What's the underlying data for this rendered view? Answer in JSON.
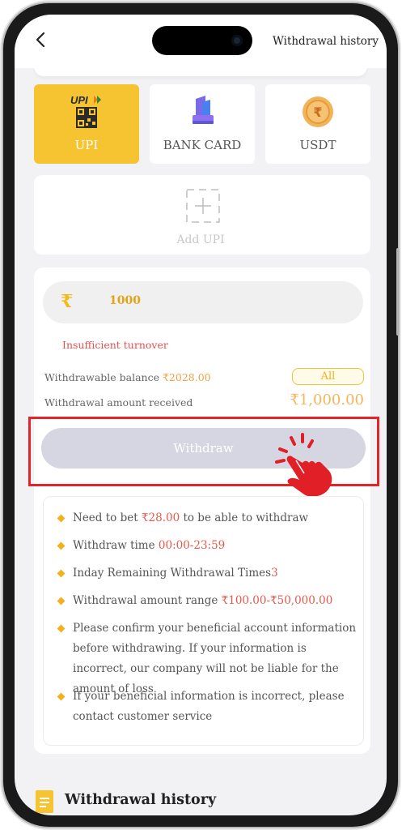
{
  "header": {
    "history_link": "Withdrawal history"
  },
  "methods": [
    {
      "label": "UPI",
      "active": true
    },
    {
      "label": "BANK CARD",
      "active": false
    },
    {
      "label": "USDT",
      "active": false
    }
  ],
  "upi_logo_text": "UPI",
  "add_upi": {
    "label": "Add UPI"
  },
  "amount": {
    "currency_symbol": "₹",
    "value": "1000",
    "warning": "Insufficient turnover"
  },
  "balance": {
    "label": "Withdrawable balance ",
    "value": "₹2028.00",
    "all_button": "All"
  },
  "received": {
    "label": "Withdrawal amount received",
    "value": "₹1,000.00"
  },
  "withdraw_button": "Withdraw",
  "rules": {
    "r1_pre": "Need to bet ",
    "r1_val": "₹28.00",
    "r1_post": " to be able to withdraw",
    "r2_pre": "Withdraw time ",
    "r2_val": "00:00-23:59",
    "r3_pre": "Inday Remaining Withdrawal Times",
    "r3_val": "3",
    "r4_pre": "Withdrawal amount range ",
    "r4_val": "₹100.00-₹50,000.00",
    "r5": "Please confirm your beneficial account information before withdrawing. If your information is incorrect, our company will not be liable for the amount of loss",
    "r6": "If your beneficial information is incorrect, please contact customer service"
  },
  "history_section": {
    "title": "Withdrawal history"
  },
  "colors": {
    "accent": "#f5c430",
    "highlight_border": "#e1252a",
    "warning": "#e2514f",
    "disabled_button": "#d6d6e3"
  }
}
